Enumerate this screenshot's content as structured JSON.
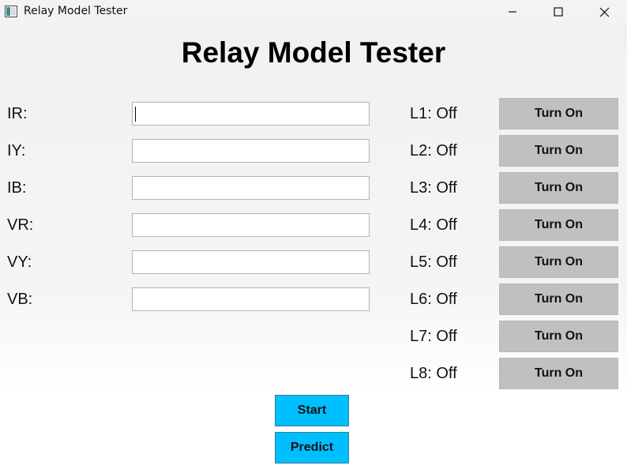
{
  "window": {
    "title": "Relay Model Tester",
    "controls": [
      "minimize-icon",
      "maximize-icon",
      "close-icon"
    ]
  },
  "heading": "Relay Model Tester",
  "inputs": [
    {
      "label": "IR:",
      "value": ""
    },
    {
      "label": "IY:",
      "value": ""
    },
    {
      "label": "IB:",
      "value": ""
    },
    {
      "label": "VR:",
      "value": ""
    },
    {
      "label": "VY:",
      "value": ""
    },
    {
      "label": "VB:",
      "value": ""
    }
  ],
  "lights": [
    {
      "status": "L1: Off",
      "button": "Turn On"
    },
    {
      "status": "L2: Off",
      "button": "Turn On"
    },
    {
      "status": "L3: Off",
      "button": "Turn On"
    },
    {
      "status": "L4: Off",
      "button": "Turn On"
    },
    {
      "status": "L5: Off",
      "button": "Turn On"
    },
    {
      "status": "L6: Off",
      "button": "Turn On"
    },
    {
      "status": "L7: Off",
      "button": "Turn On"
    },
    {
      "status": "L8: Off",
      "button": "Turn On"
    }
  ],
  "actions": {
    "start": "Start",
    "predict": "Predict"
  },
  "colors": {
    "action_button": "#00bfff",
    "toggle_button": "#c0c0c0"
  }
}
